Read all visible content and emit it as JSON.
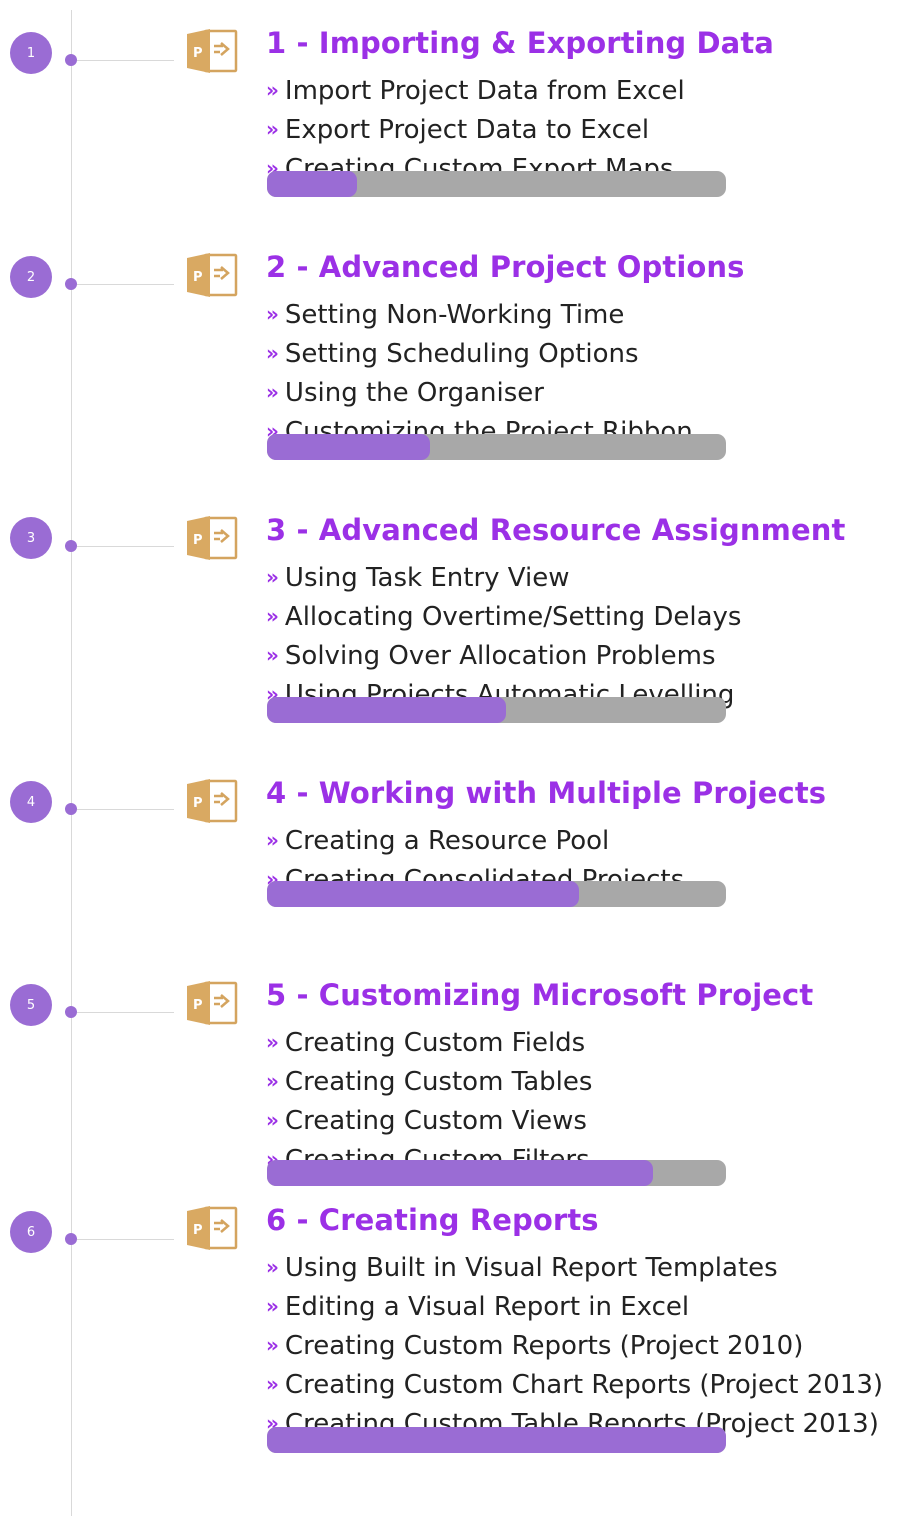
{
  "colors": {
    "accent": "#9b30e6",
    "marker": "#9a6cd4",
    "track": "#a8a8a8",
    "line": "#d9d9d9"
  },
  "modules": [
    {
      "number": "1",
      "title": "1 - Importing & Exporting Data",
      "icon": "project-file-icon",
      "lessons": [
        "Import Project Data from Excel",
        "Export Project Data to Excel",
        "Creating Custom Export Maps"
      ],
      "progress": 0.195
    },
    {
      "number": "2",
      "title": "2 - Advanced Project Options",
      "icon": "project-file-icon",
      "lessons": [
        "Setting Non-Working Time",
        "Setting Scheduling Options",
        "Using the Organiser",
        "Customizing the Project Ribbon"
      ],
      "progress": 0.355
    },
    {
      "number": "3",
      "title": "3 - Advanced Resource Assignment",
      "icon": "project-file-icon",
      "lessons": [
        "Using Task Entry View",
        "Allocating Overtime/Setting Delays",
        "Solving Over Allocation Problems",
        "Using Projects Automatic Levelling"
      ],
      "progress": 0.52
    },
    {
      "number": "4",
      "title": "4 - Working with Multiple Projects",
      "icon": "project-file-icon",
      "lessons": [
        "Creating a Resource Pool",
        "Creating Consolidated Projects"
      ],
      "progress": 0.68
    },
    {
      "number": "5",
      "title": "5 - Customizing Microsoft Project",
      "icon": "project-file-icon",
      "lessons": [
        "Creating Custom Fields",
        "Creating Custom Tables",
        "Creating Custom Views",
        "Creating Custom Filters"
      ],
      "progress": 0.84
    },
    {
      "number": "6",
      "title": "6 - Creating Reports",
      "icon": "project-file-icon",
      "lessons": [
        "Using Built in Visual Report Templates",
        "Editing a Visual Report in Excel",
        "Creating Custom Reports (Project 2010)",
        "Creating Custom Chart Reports (Project 2013)",
        "Creating Custom Table Reports (Project 2013)"
      ],
      "progress": 1.0
    }
  ]
}
